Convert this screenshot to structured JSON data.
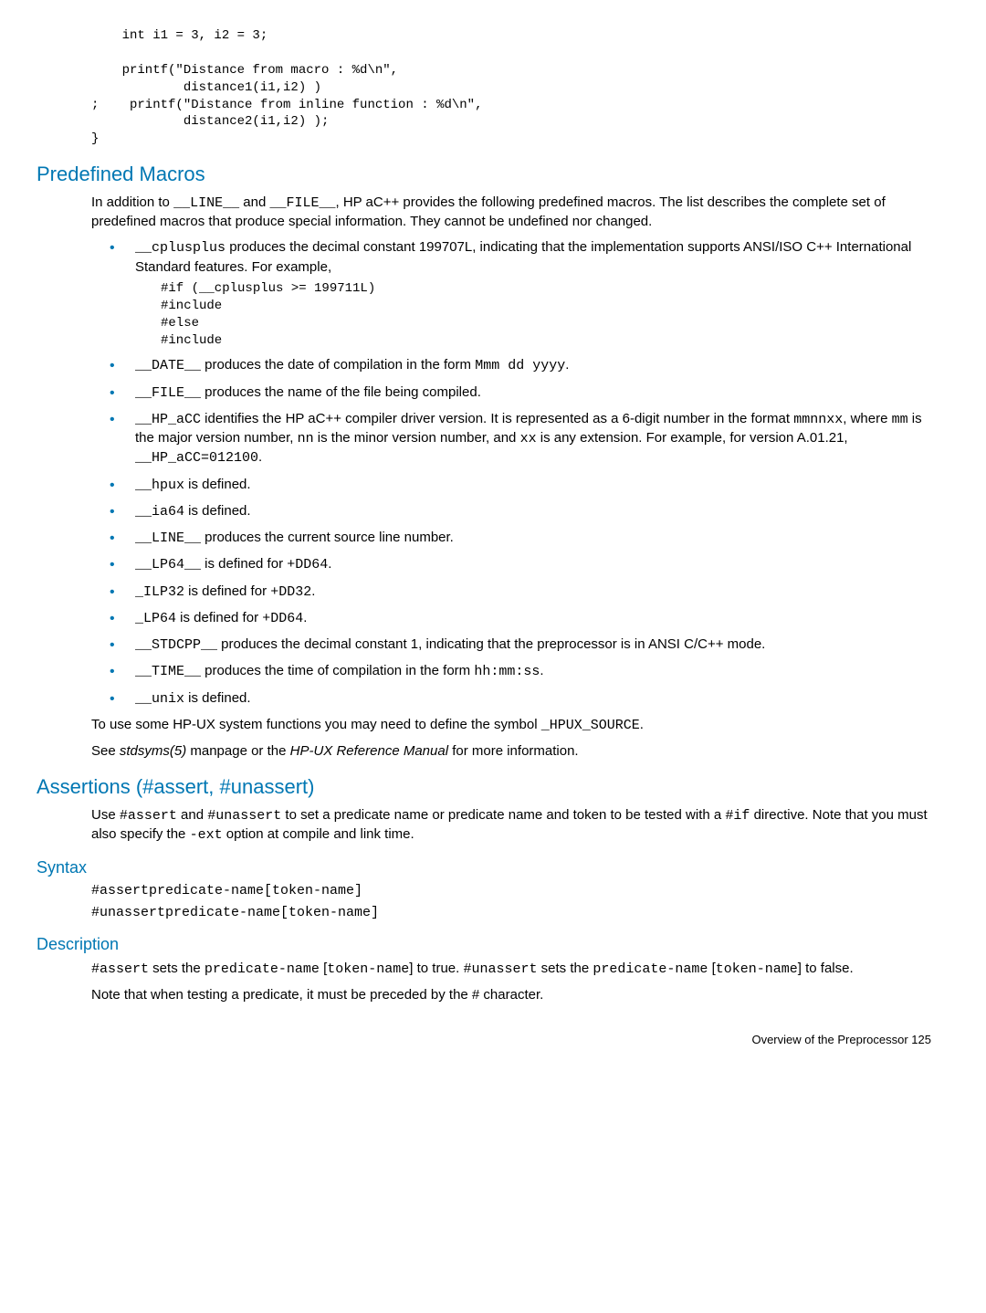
{
  "code1": "    int i1 = 3, i2 = 3;\n\n    printf(\"Distance from macro : %d\\n\",\n            distance1(i1,i2) )\n;    printf(\"Distance from inline function : %d\\n\",\n            distance2(i1,i2) );\n}",
  "h_predef": "Predefined Macros",
  "predef_intro_a": "In addition to ",
  "predef_intro_b": " and ",
  "predef_intro_c": ", HP aC++ provides the following predefined macros. The list describes the complete set of predefined macros that produce special information. They cannot be undefined nor changed.",
  "line_macro": "__LINE__",
  "file_macro": "__FILE__",
  "li1_code": "__cplusplus",
  "li1_text": " produces the decimal constant 199707L, indicating that the implementation supports ANSI/ISO C++ International Standard features. For example,",
  "li1_sub": "#if (__cplusplus >= 199711L)\n#include\n#else\n#include",
  "li2_code": "__DATE__",
  "li2_text_a": " produces the date of compilation in the form ",
  "li2_text_b": ".",
  "li2_mono": "Mmm dd yyyy",
  "li3_code": "__FILE__",
  "li3_text": " produces the name of the file being compiled.",
  "li4_code": "__HP_aCC",
  "li4_text_a": " identifies the HP aC++ compiler driver version. It is represented as a 6-digit number in the format ",
  "li4_mono1": "mmnnxx",
  "li4_text_b": ", where ",
  "li4_mono2": "mm",
  "li4_text_c": " is the major version number, ",
  "li4_mono3": "nn",
  "li4_text_d": " is the minor version number, and ",
  "li4_mono4": "xx",
  "li4_text_e": " is any extension. For example, for version A.01.21, ",
  "li4_mono5": "__HP_aCC=012100",
  "li4_text_f": ".",
  "li5_code": "__hpux",
  "li5_text": " is defined.",
  "li6_code": "__ia64",
  "li6_text": " is defined.",
  "li7_code": "__LINE__",
  "li7_text": " produces the current source line number.",
  "li8_code": "__LP64__",
  "li8_text_a": " is defined for ",
  "li8_mono": "+DD64",
  "li8_text_b": ".",
  "li9_code": "_ILP32",
  "li9_text_a": " is defined for ",
  "li9_mono": "+DD32",
  "li9_text_b": ".",
  "li10_code": "_LP64",
  "li10_text_a": " is defined for ",
  "li10_mono": "+DD64",
  "li10_text_b": ".",
  "li11_code": "__STDCPP__",
  "li11_text": " produces the decimal constant 1, indicating that the preprocessor is in ANSI C/C++ mode.",
  "li12_code": "__TIME__",
  "li12_text_a": " produces the time of compilation in the form ",
  "li12_mono": "hh:mm:ss",
  "li12_text_b": ".",
  "li13_code": "__unix",
  "li13_text": " is defined.",
  "predef_after_a": "To use some HP-UX system functions you may need to define the symbol ",
  "predef_after_mono": "_HPUX_SOURCE",
  "predef_after_b": ".",
  "predef_see_a": "See ",
  "predef_see_em1": "stdsyms(5)",
  "predef_see_b": " manpage or the ",
  "predef_see_em2": "HP-UX Reference Manual",
  "predef_see_c": " for more information.",
  "h_assert": "Assertions (#assert, #unassert)",
  "assert_intro_a": "Use ",
  "assert_m1": "#assert",
  "assert_intro_b": " and ",
  "assert_m2": "#unassert",
  "assert_intro_c": " to set a predicate name or predicate name and token to be tested with a ",
  "assert_m3": "#if",
  "assert_intro_d": " directive. Note that you must also specify the ",
  "assert_m4": "-ext",
  "assert_intro_e": " option at compile and link time.",
  "h_syntax": "Syntax",
  "syntax1": "#assertpredicate-name[token-name]",
  "syntax2": "#unassertpredicate-name[token-name]",
  "h_desc": "Description",
  "desc_m1": "#assert",
  "desc_a": " sets the ",
  "desc_m2": "predicate-name",
  "desc_b": " [",
  "desc_m3": "token-name",
  "desc_c": "] to true. ",
  "desc_m4": "#unassert",
  "desc_d": " sets the ",
  "desc_m5": "predicate-name",
  "desc_e": " [",
  "desc_m6": "token-name",
  "desc_f": "] to false.",
  "desc_note": "Note that when testing a predicate, it must be preceded by the # character.",
  "footer": "Overview of the Preprocessor    125"
}
